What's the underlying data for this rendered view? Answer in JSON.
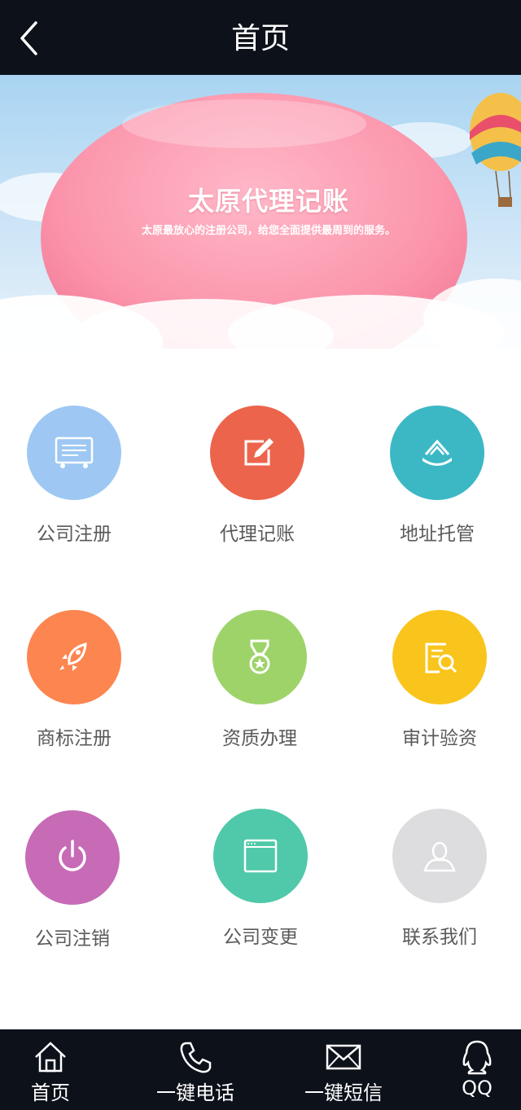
{
  "header": {
    "title": "首页"
  },
  "banner": {
    "title": "太原代理记账",
    "subtitle": "太原最放心的注册公司，给您全面提供最周到的服务。"
  },
  "services": [
    {
      "label": "公司注册",
      "color": "#9ec8f3",
      "icon": "certificate-icon"
    },
    {
      "label": "代理记账",
      "color": "#ec644b",
      "icon": "edit-icon"
    },
    {
      "label": "地址托管",
      "color": "#3cb8c5",
      "icon": "building-icon"
    },
    {
      "label": "商标注册",
      "color": "#fd8550",
      "icon": "rocket-icon"
    },
    {
      "label": "资质办理",
      "color": "#9ed36a",
      "icon": "medal-icon"
    },
    {
      "label": "审计验资",
      "color": "#f9c51c",
      "icon": "document-search-icon"
    },
    {
      "label": "公司注销",
      "color": "#c76bb6",
      "icon": "power-icon"
    },
    {
      "label": "公司变更",
      "color": "#4fc9a9",
      "icon": "browser-window-icon"
    },
    {
      "label": "联系我们",
      "color": "#dddddf",
      "icon": "person-icon"
    }
  ],
  "nav": [
    {
      "label": "首页",
      "icon": "home-icon"
    },
    {
      "label": "一键电话",
      "icon": "phone-icon"
    },
    {
      "label": "一键短信",
      "icon": "mail-icon"
    },
    {
      "label": "QQ",
      "icon": "qq-icon"
    }
  ]
}
